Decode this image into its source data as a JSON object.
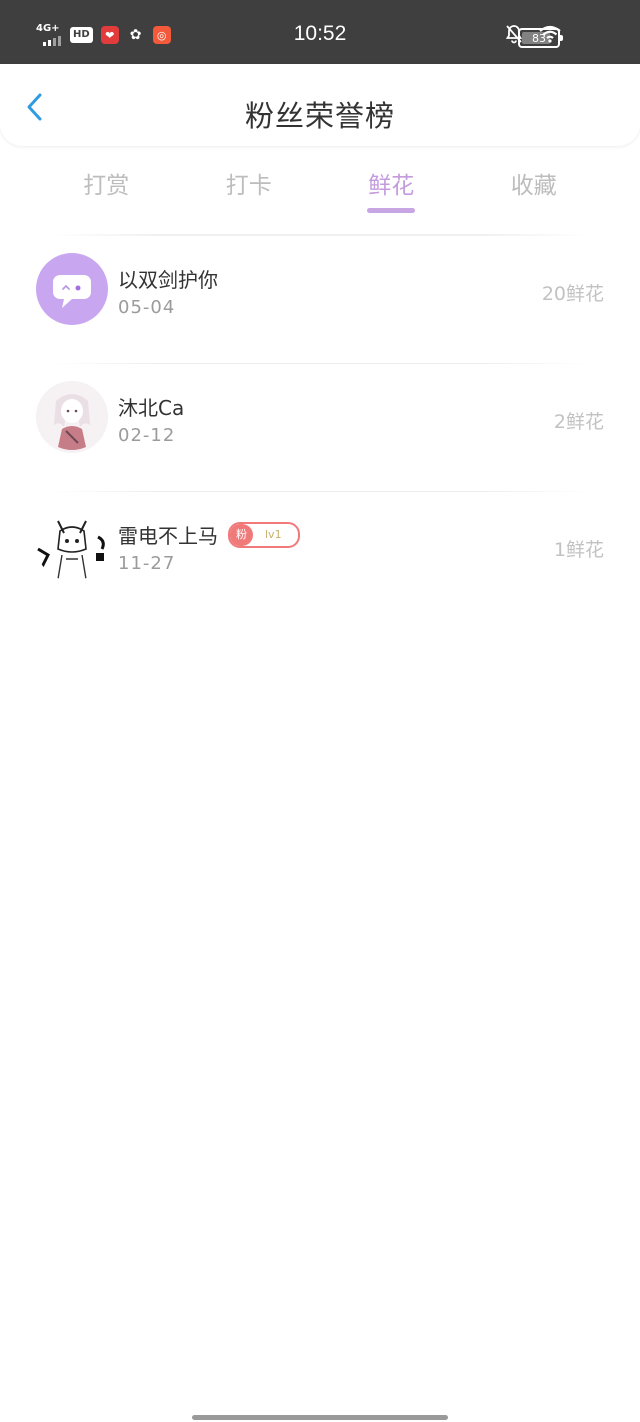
{
  "status_bar": {
    "network": "4G+",
    "hd": "HD",
    "time": "10:52",
    "battery": "83",
    "icons": [
      "signal-icon",
      "hd-icon",
      "app-heart-icon",
      "wechat-icon",
      "app-orange-icon",
      "mute-bell-icon",
      "wifi-icon",
      "battery-icon"
    ]
  },
  "header": {
    "title": "粉丝荣誉榜",
    "back_icon": "chevron-left-icon"
  },
  "tabs": [
    {
      "label": "打赏",
      "active": false
    },
    {
      "label": "打卡",
      "active": false
    },
    {
      "label": "鲜花",
      "active": true
    },
    {
      "label": "收藏",
      "active": false
    }
  ],
  "fans": [
    {
      "name": "以双剑护你",
      "date": "05-04",
      "amount": "20鲜花"
    },
    {
      "name": "沐北Ca",
      "date": "02-12",
      "amount": "2鲜花"
    },
    {
      "name": "雷电不上马",
      "date": "11-27",
      "amount": "1鲜花",
      "badge": {
        "left": "粉",
        "right": "lv1"
      }
    }
  ],
  "colors": {
    "accent": "#c49bdc",
    "status_bar": "#3f3f3f",
    "back": "#2f9be0",
    "badge": "#f07a7a"
  }
}
